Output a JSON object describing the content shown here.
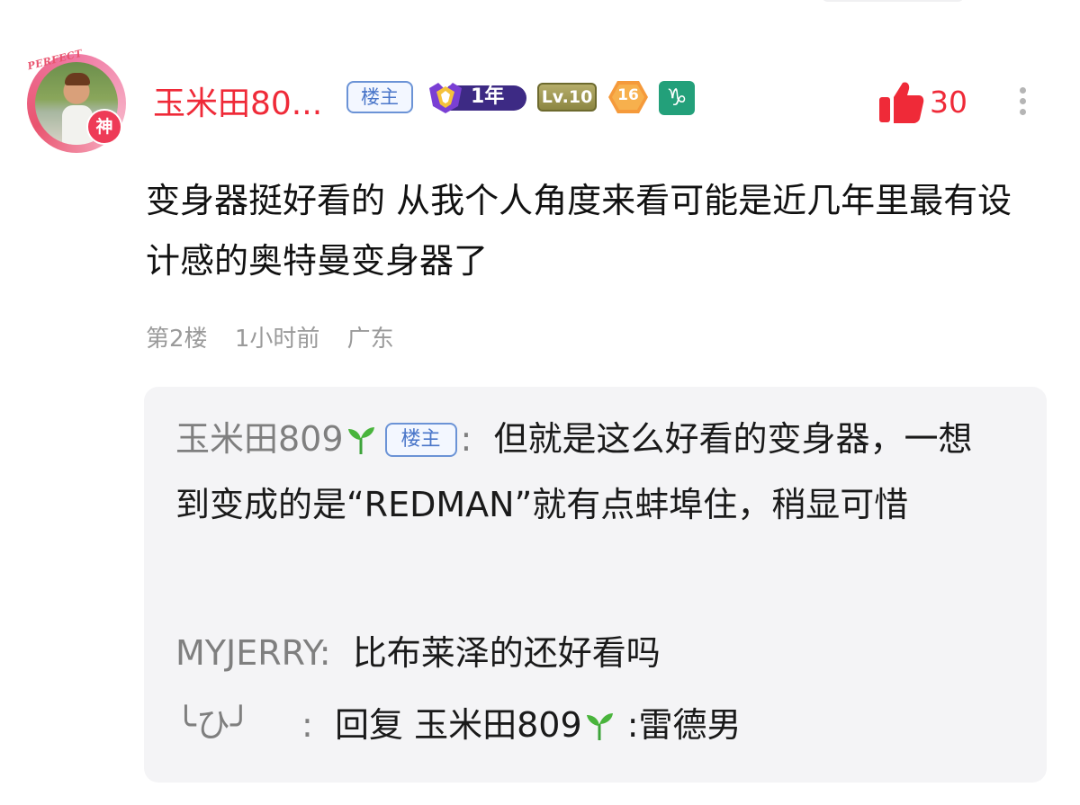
{
  "post": {
    "username": "玉米田80...",
    "owner_tag": "楼主",
    "year_badge": "1年",
    "level_badge": "Lv.10",
    "fans_level": "16",
    "zodiac_symbol": "♑",
    "likes": "30",
    "avatar_text": "PERFECT",
    "avatar_badge": "神",
    "content": "变身器挺好看的 从我个人角度来看可能是近几年里最有设计感的奥特曼变身器了",
    "floor": "第2楼",
    "time": "1小时前",
    "location": "广东"
  },
  "replies": [
    {
      "name": "玉米田809",
      "tag": "楼主",
      "sep": ":",
      "text": "但就是这么好看的变身器，一想到变成的是“REDMAN”就有点蚌埠住，稍显可惜"
    },
    {
      "name": "MYJERRY",
      "sep": ":",
      "text": "比布莱泽的还好看吗"
    },
    {
      "name": "╰ひ╯",
      "sep": ":",
      "reply_word": "回复",
      "reply_to": "玉米田809",
      "text": ":雷德男"
    }
  ]
}
